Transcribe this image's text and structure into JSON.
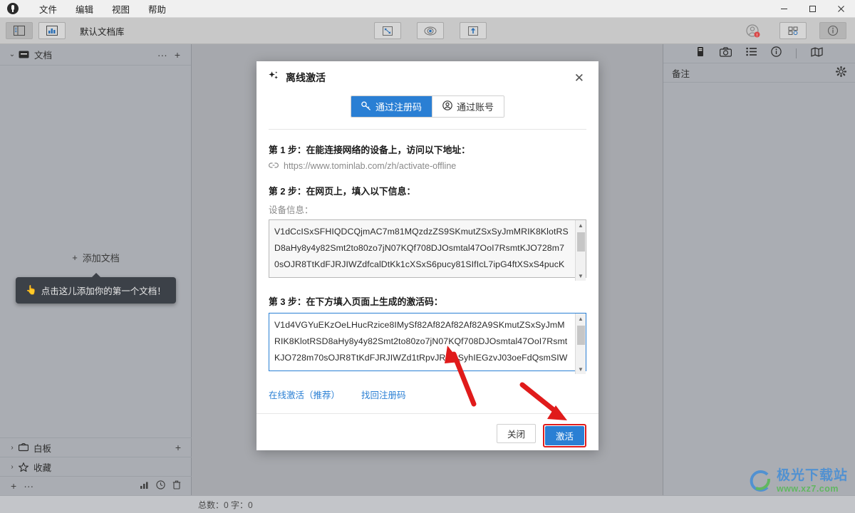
{
  "titlebar": {
    "app_icon": "app-logo-icon",
    "menus": [
      "文件",
      "编辑",
      "视图",
      "帮助"
    ],
    "minimize": "–",
    "maximize": "□",
    "close": "✕"
  },
  "toolbar": {
    "library_label": "默认文档库",
    "buttons": [
      "sidebar-toggle-icon",
      "chart-view-icon",
      "fit-screen-icon",
      "presentation-icon",
      "export-icon",
      "account-icon",
      "grid-icon",
      "info-icon"
    ]
  },
  "sidebar_left": {
    "section": {
      "label": "文档",
      "chevron": "⌄",
      "more": "···",
      "add": "+"
    },
    "empty": {
      "add_doc_label": "添加文档",
      "add_doc_plus": "+",
      "tooltip": "点击这儿添加你的第一个文档！",
      "tooltip_icon": "pointing-hand-icon"
    },
    "rows": [
      {
        "label": "白板",
        "chevron": "›",
        "icon": "whiteboard-icon",
        "add": "+"
      },
      {
        "label": "收藏",
        "chevron": "›",
        "icon": "star-icon",
        "add": ""
      }
    ],
    "footer": {
      "add": "+",
      "more": "···"
    }
  },
  "sidebar_right": {
    "icons": [
      "book-icon",
      "camera-icon",
      "list-icon",
      "info-circle-icon",
      "map-icon"
    ],
    "panel_title": "备注",
    "settings_icon": "gear-icon"
  },
  "statusbar": {
    "icons": [
      "chart-icon",
      "clock-icon",
      "trash-icon"
    ],
    "text": "总数：0   字：0"
  },
  "dialog": {
    "title": "离线激活",
    "title_icon": "sparkle-icon",
    "close": "✕",
    "tabs": [
      {
        "label": "通过注册码",
        "icon": "key-icon",
        "active": true
      },
      {
        "label": "通过账号",
        "icon": "user-circle-icon",
        "active": false
      }
    ],
    "step1": {
      "title": "第 1 步：在能连接网络的设备上，访问以下地址：",
      "link_icon": "link-icon",
      "url": "https://www.tominlab.com/zh/activate-offline"
    },
    "step2": {
      "title": "第 2 步：在网页上，填入以下信息：",
      "field_label": "设备信息：",
      "value": "V1dCcISxSFHIQDCQjmAC7m81MQzdzZS9SKmutZSxSyJmMRIK8KlotRSD8aHy8y4y82Smt2to80zo7jN07KQf708DJOsmtal47OoI7RsmtKJO728m70sOJR8TtKdFJRJIWZdfcalDtKk1cXSxS6pucy81SIfIcL7ipG4ftXSxS4pucK"
    },
    "step3": {
      "title": "第 3 步：在下方填入页面上生成的激活码：",
      "value": "V1d4VGYuEKzOeLHucRzice8IMySf82Af82Af82Af82A9SKmutZSxSyJmMRIK8KlotRSD8aHy8y4y82Smt2to80zo7jN07KQf708DJOsmtal47OoI7RsmtKJO728m70sOJR8TtKdFJRJIWZd1tRpvJRm4SyhIEGzvJ03oeFdQsmSIW",
      "placeholder": ""
    },
    "links": [
      "在线激活（推荐）",
      "找回注册码"
    ],
    "footer": {
      "close_label": "关闭",
      "activate_label": "激活"
    },
    "accent_color": "#2a7fd4",
    "highlight_color": "#e01b1b"
  },
  "watermark": {
    "main": "极光下载站",
    "sub": "www.xz7.com"
  }
}
